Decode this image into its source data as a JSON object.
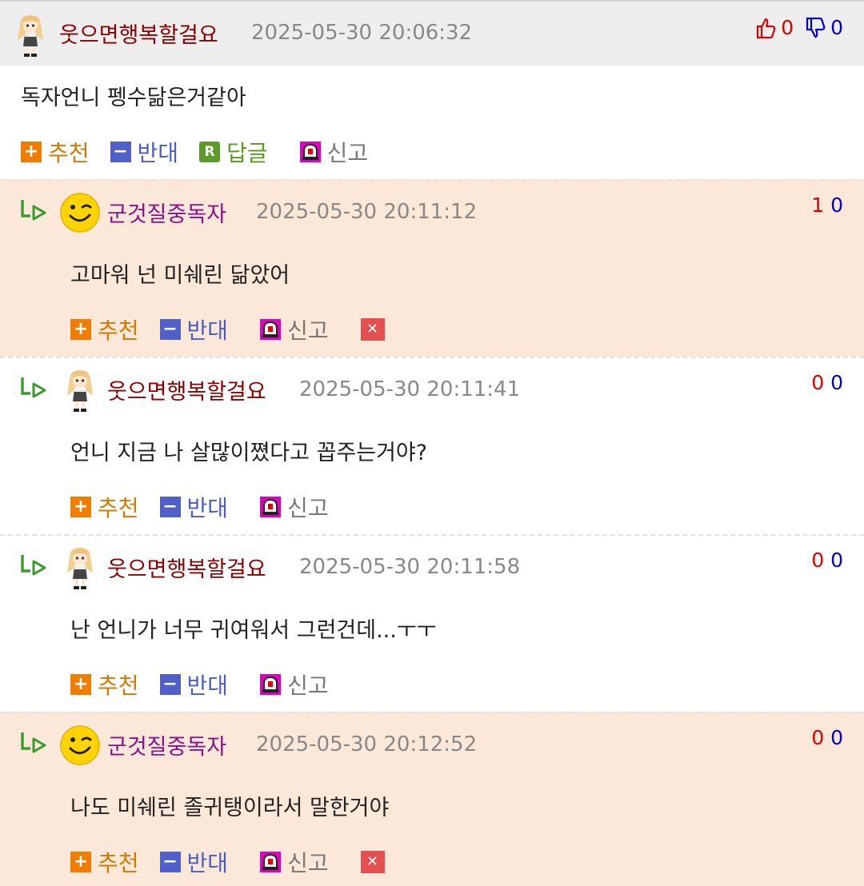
{
  "top_comment": {
    "nickname": "웃으면행복할걸요",
    "date": "2025-05-30 20:06:32",
    "up_count": "0",
    "down_count": "0",
    "body": "독자언니 펭수닮은거같아",
    "actions": {
      "recommend": "추천",
      "oppose": "반대",
      "reply": "답글",
      "report": "신고"
    }
  },
  "replies": [
    {
      "nickname": "군것질중독자",
      "date": "2025-05-30 20:11:12",
      "up_count": "1",
      "down_count": "0",
      "body": "고마워 넌 미쉐린 닮았어",
      "actions": {
        "recommend": "추천",
        "oppose": "반대",
        "report": "신고"
      }
    },
    {
      "nickname": "웃으면행복할걸요",
      "date": "2025-05-30 20:11:41",
      "up_count": "0",
      "down_count": "0",
      "body": "언니 지금 나 살많이쪘다고 꼽주는거야?",
      "actions": {
        "recommend": "추천",
        "oppose": "반대",
        "report": "신고"
      }
    },
    {
      "nickname": "웃으면행복할걸요",
      "date": "2025-05-30 20:11:58",
      "up_count": "0",
      "down_count": "0",
      "body": "난 언니가 너무 귀여워서 그런건데...ㅜㅜ",
      "actions": {
        "recommend": "추천",
        "oppose": "반대",
        "report": "신고"
      }
    },
    {
      "nickname": "군것질중독자",
      "date": "2025-05-30 20:12:52",
      "up_count": "0",
      "down_count": "0",
      "body": "나도 미쉐린 졸귀탱이라서 말한거야",
      "actions": {
        "recommend": "추천",
        "oppose": "반대",
        "report": "신고"
      }
    }
  ],
  "colors": {
    "highlight_bg": "#fbe8d8",
    "header_bg": "#eeeeee",
    "recommend": "#f07c00",
    "oppose": "#5060c8",
    "reply": "#5d9b28",
    "report": "#e000c0",
    "delete": "#e45050"
  },
  "icons": {
    "top_avatar": "anime-girl-avatar-icon",
    "reply_arrow": "reply-arrow-icon",
    "smiley_avatar": "smiley-avatar-icon",
    "thumb_up": "thumb-up-icon",
    "thumb_down": "thumb-down-icon",
    "report": "siren-icon",
    "delete": "close-icon"
  }
}
